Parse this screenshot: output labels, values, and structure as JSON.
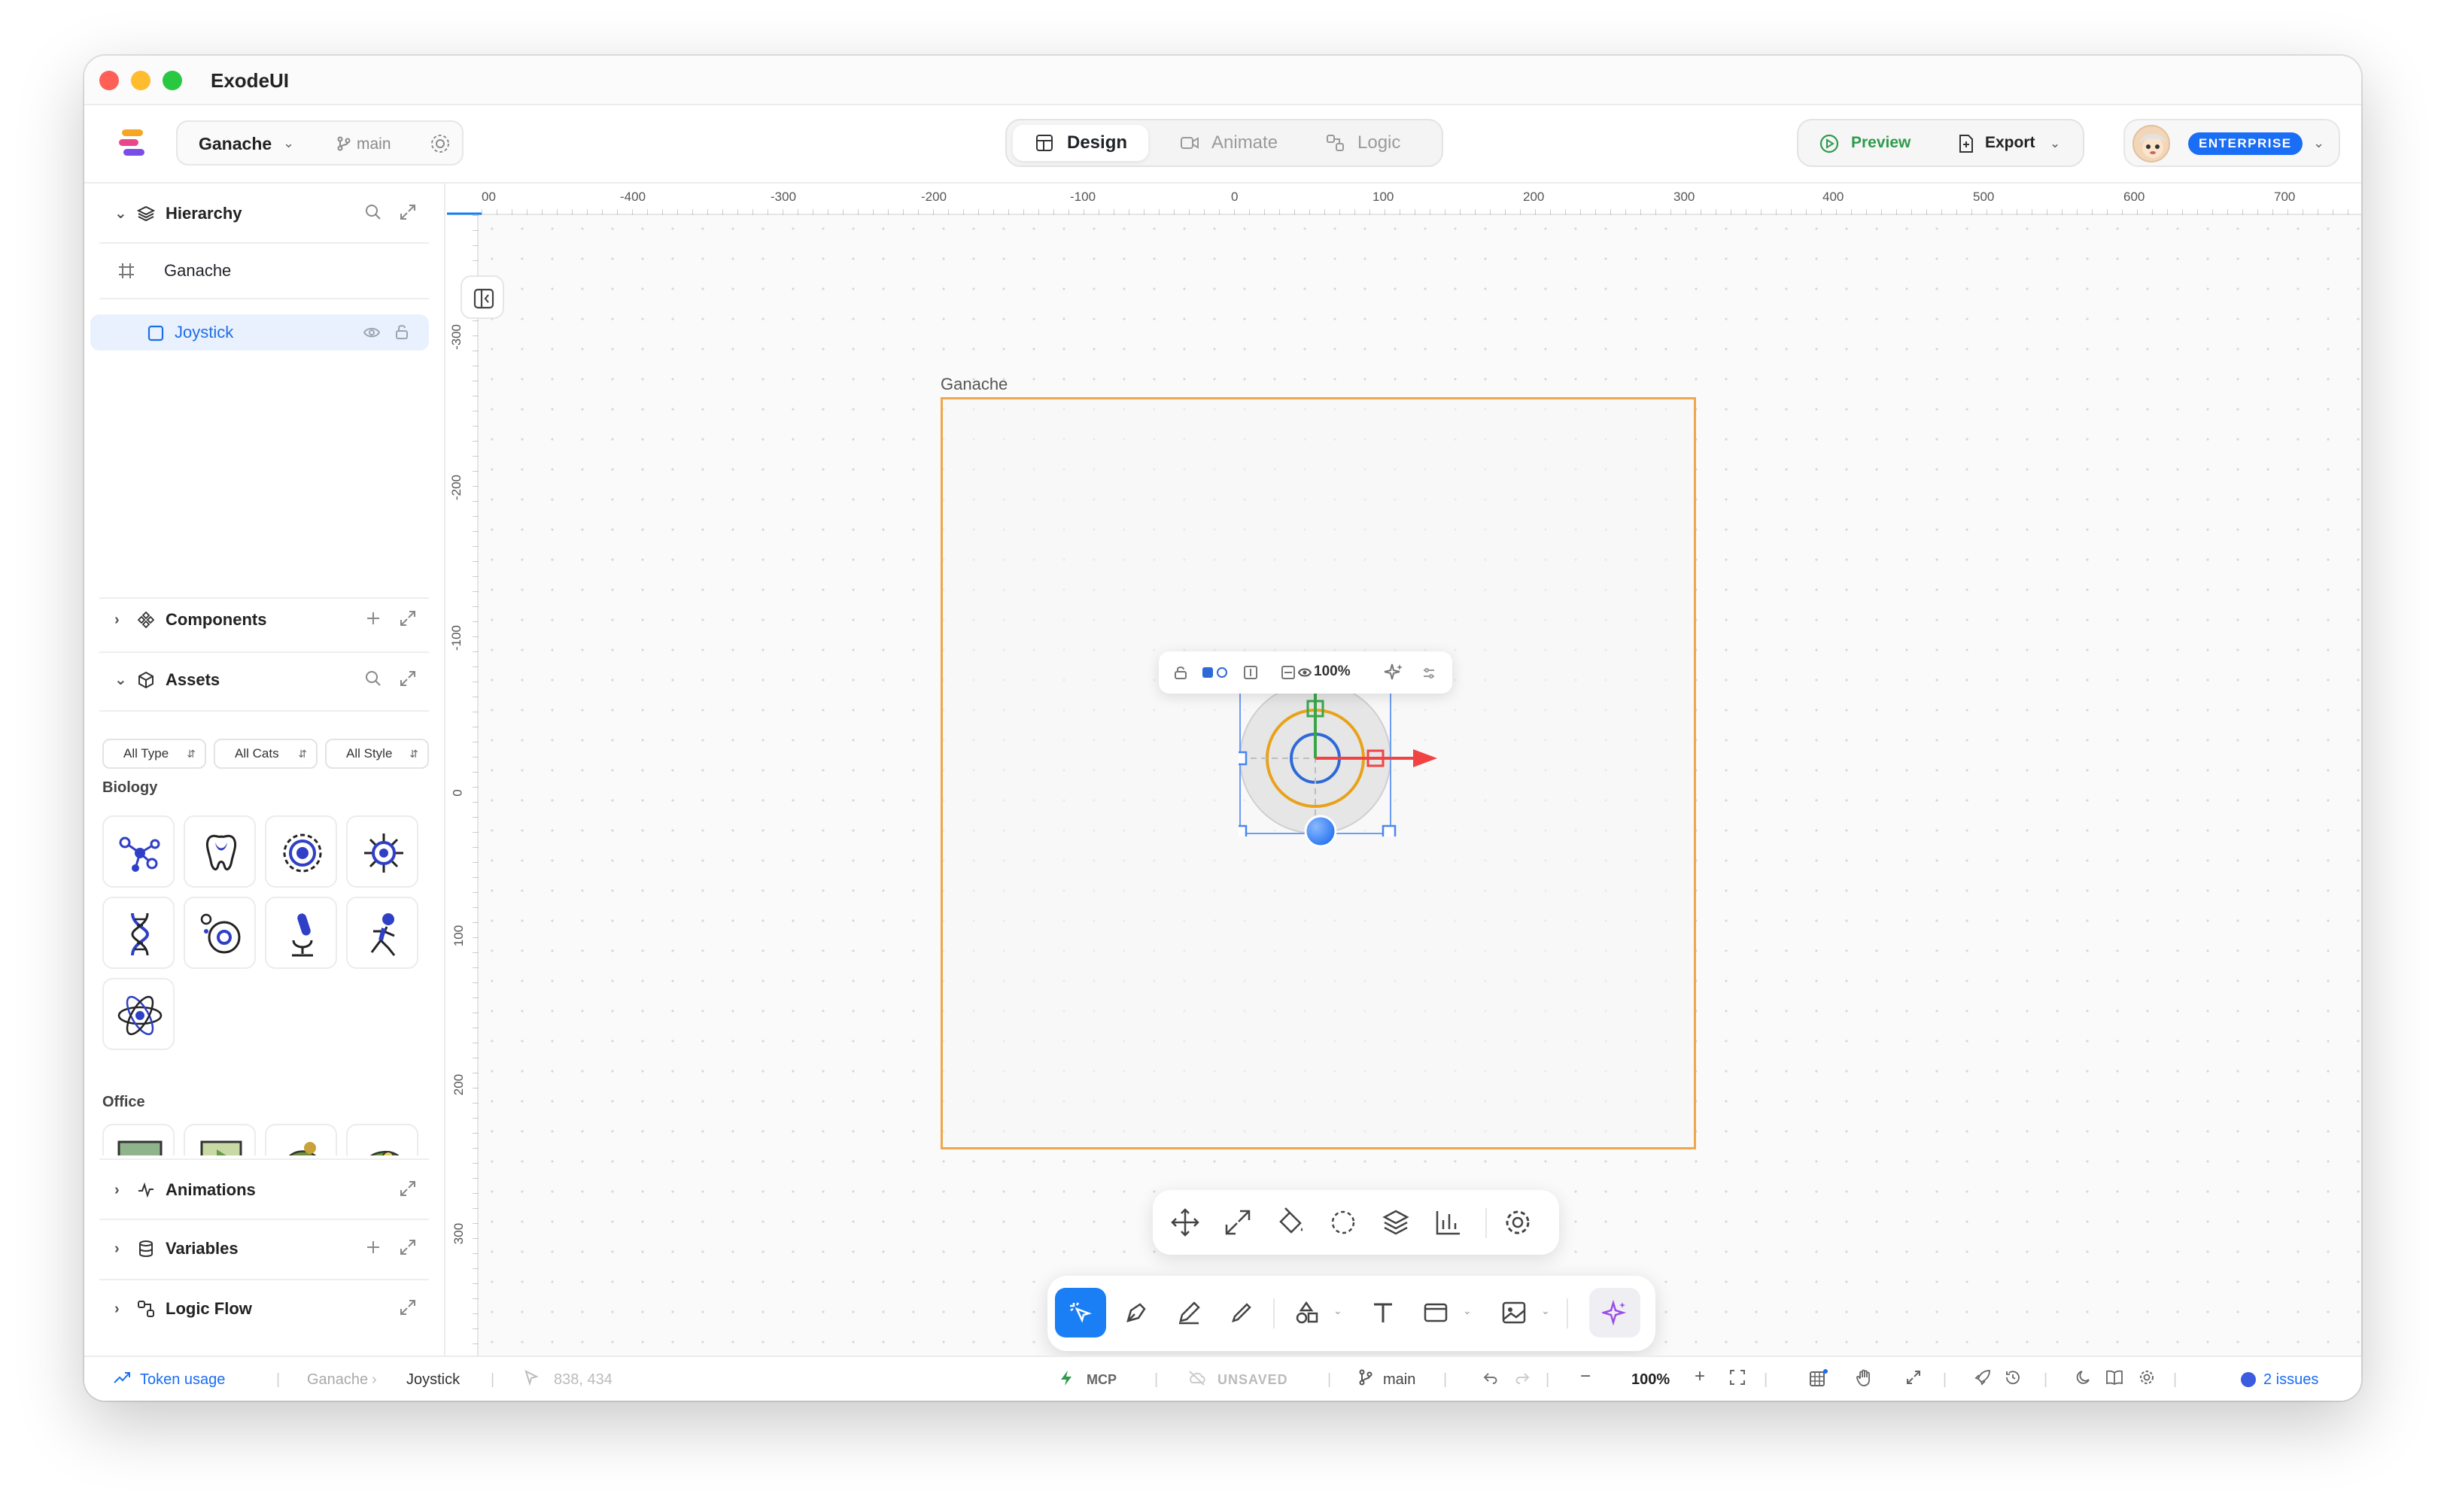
{
  "window": {
    "title": "ExodeUI"
  },
  "toolbar": {
    "project_name": "Ganache",
    "branch": "main",
    "tabs": [
      {
        "label": "Design",
        "active": true
      },
      {
        "label": "Animate",
        "active": false
      },
      {
        "label": "Logic",
        "active": false
      }
    ],
    "preview_label": "Preview",
    "export_label": "Export",
    "plan_badge": "ENTERPRISE"
  },
  "sidebar": {
    "hierarchy_title": "Hierarchy",
    "frame_item": "Ganache",
    "selected_layer": "Joystick",
    "components_title": "Components",
    "assets_title": "Assets",
    "filters": [
      "All Type",
      "All Cats",
      "All Style"
    ],
    "category_biology": "Biology",
    "category_office": "Office",
    "animations_title": "Animations",
    "variables_title": "Variables",
    "logic_flow_title": "Logic Flow"
  },
  "canvas": {
    "frame_label": "Ganache",
    "opacity": "100%",
    "ruler_top": [
      "00",
      "-400",
      "-300",
      "-200",
      "-100",
      "0",
      "100",
      "200",
      "300",
      "400",
      "500",
      "600",
      "700"
    ],
    "ruler_left": [
      "-300",
      "-200",
      "-100",
      "0",
      "100",
      "200",
      "300"
    ]
  },
  "statusbar": {
    "token_usage": "Token usage",
    "crumb_frame": "Ganache",
    "crumb_layer": "Joystick",
    "cursor_coords": "838, 434",
    "mcp": "MCP",
    "save_state": "UNSAVED",
    "branch": "main",
    "zoom": "100%",
    "issues": "2 issues"
  },
  "colors": {
    "accent": "#1a7ef5",
    "frame_border": "#f0a64a",
    "preview_green": "#2e9b4c",
    "asset_blue": "#2f3fc6",
    "axis_x": "#f04444",
    "axis_y": "#3aa64a"
  }
}
